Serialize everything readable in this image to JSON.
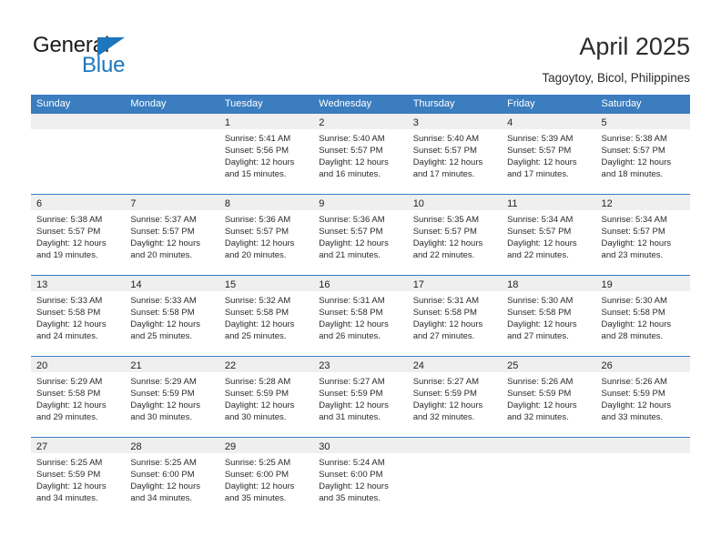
{
  "brand": {
    "name_part1": "General",
    "name_part2": "Blue",
    "triangle_color": "#1e76bd"
  },
  "header": {
    "title": "April 2025",
    "subtitle": "Tagoytoy, Bicol, Philippines"
  },
  "theme": {
    "header_blue": "#3b7dbf",
    "daynum_band": "#efefef",
    "text": "#2a2a2a"
  },
  "calendar": {
    "weekday_headers": [
      "Sunday",
      "Monday",
      "Tuesday",
      "Wednesday",
      "Thursday",
      "Friday",
      "Saturday"
    ],
    "weeks": [
      [
        {
          "day": "",
          "sunrise": "",
          "sunset": "",
          "daylight_line1": "",
          "daylight_line2": ""
        },
        {
          "day": "",
          "sunrise": "",
          "sunset": "",
          "daylight_line1": "",
          "daylight_line2": ""
        },
        {
          "day": "1",
          "sunrise": "Sunrise: 5:41 AM",
          "sunset": "Sunset: 5:56 PM",
          "daylight_line1": "Daylight: 12 hours",
          "daylight_line2": "and 15 minutes."
        },
        {
          "day": "2",
          "sunrise": "Sunrise: 5:40 AM",
          "sunset": "Sunset: 5:57 PM",
          "daylight_line1": "Daylight: 12 hours",
          "daylight_line2": "and 16 minutes."
        },
        {
          "day": "3",
          "sunrise": "Sunrise: 5:40 AM",
          "sunset": "Sunset: 5:57 PM",
          "daylight_line1": "Daylight: 12 hours",
          "daylight_line2": "and 17 minutes."
        },
        {
          "day": "4",
          "sunrise": "Sunrise: 5:39 AM",
          "sunset": "Sunset: 5:57 PM",
          "daylight_line1": "Daylight: 12 hours",
          "daylight_line2": "and 17 minutes."
        },
        {
          "day": "5",
          "sunrise": "Sunrise: 5:38 AM",
          "sunset": "Sunset: 5:57 PM",
          "daylight_line1": "Daylight: 12 hours",
          "daylight_line2": "and 18 minutes."
        }
      ],
      [
        {
          "day": "6",
          "sunrise": "Sunrise: 5:38 AM",
          "sunset": "Sunset: 5:57 PM",
          "daylight_line1": "Daylight: 12 hours",
          "daylight_line2": "and 19 minutes."
        },
        {
          "day": "7",
          "sunrise": "Sunrise: 5:37 AM",
          "sunset": "Sunset: 5:57 PM",
          "daylight_line1": "Daylight: 12 hours",
          "daylight_line2": "and 20 minutes."
        },
        {
          "day": "8",
          "sunrise": "Sunrise: 5:36 AM",
          "sunset": "Sunset: 5:57 PM",
          "daylight_line1": "Daylight: 12 hours",
          "daylight_line2": "and 20 minutes."
        },
        {
          "day": "9",
          "sunrise": "Sunrise: 5:36 AM",
          "sunset": "Sunset: 5:57 PM",
          "daylight_line1": "Daylight: 12 hours",
          "daylight_line2": "and 21 minutes."
        },
        {
          "day": "10",
          "sunrise": "Sunrise: 5:35 AM",
          "sunset": "Sunset: 5:57 PM",
          "daylight_line1": "Daylight: 12 hours",
          "daylight_line2": "and 22 minutes."
        },
        {
          "day": "11",
          "sunrise": "Sunrise: 5:34 AM",
          "sunset": "Sunset: 5:57 PM",
          "daylight_line1": "Daylight: 12 hours",
          "daylight_line2": "and 22 minutes."
        },
        {
          "day": "12",
          "sunrise": "Sunrise: 5:34 AM",
          "sunset": "Sunset: 5:57 PM",
          "daylight_line1": "Daylight: 12 hours",
          "daylight_line2": "and 23 minutes."
        }
      ],
      [
        {
          "day": "13",
          "sunrise": "Sunrise: 5:33 AM",
          "sunset": "Sunset: 5:58 PM",
          "daylight_line1": "Daylight: 12 hours",
          "daylight_line2": "and 24 minutes."
        },
        {
          "day": "14",
          "sunrise": "Sunrise: 5:33 AM",
          "sunset": "Sunset: 5:58 PM",
          "daylight_line1": "Daylight: 12 hours",
          "daylight_line2": "and 25 minutes."
        },
        {
          "day": "15",
          "sunrise": "Sunrise: 5:32 AM",
          "sunset": "Sunset: 5:58 PM",
          "daylight_line1": "Daylight: 12 hours",
          "daylight_line2": "and 25 minutes."
        },
        {
          "day": "16",
          "sunrise": "Sunrise: 5:31 AM",
          "sunset": "Sunset: 5:58 PM",
          "daylight_line1": "Daylight: 12 hours",
          "daylight_line2": "and 26 minutes."
        },
        {
          "day": "17",
          "sunrise": "Sunrise: 5:31 AM",
          "sunset": "Sunset: 5:58 PM",
          "daylight_line1": "Daylight: 12 hours",
          "daylight_line2": "and 27 minutes."
        },
        {
          "day": "18",
          "sunrise": "Sunrise: 5:30 AM",
          "sunset": "Sunset: 5:58 PM",
          "daylight_line1": "Daylight: 12 hours",
          "daylight_line2": "and 27 minutes."
        },
        {
          "day": "19",
          "sunrise": "Sunrise: 5:30 AM",
          "sunset": "Sunset: 5:58 PM",
          "daylight_line1": "Daylight: 12 hours",
          "daylight_line2": "and 28 minutes."
        }
      ],
      [
        {
          "day": "20",
          "sunrise": "Sunrise: 5:29 AM",
          "sunset": "Sunset: 5:58 PM",
          "daylight_line1": "Daylight: 12 hours",
          "daylight_line2": "and 29 minutes."
        },
        {
          "day": "21",
          "sunrise": "Sunrise: 5:29 AM",
          "sunset": "Sunset: 5:59 PM",
          "daylight_line1": "Daylight: 12 hours",
          "daylight_line2": "and 30 minutes."
        },
        {
          "day": "22",
          "sunrise": "Sunrise: 5:28 AM",
          "sunset": "Sunset: 5:59 PM",
          "daylight_line1": "Daylight: 12 hours",
          "daylight_line2": "and 30 minutes."
        },
        {
          "day": "23",
          "sunrise": "Sunrise: 5:27 AM",
          "sunset": "Sunset: 5:59 PM",
          "daylight_line1": "Daylight: 12 hours",
          "daylight_line2": "and 31 minutes."
        },
        {
          "day": "24",
          "sunrise": "Sunrise: 5:27 AM",
          "sunset": "Sunset: 5:59 PM",
          "daylight_line1": "Daylight: 12 hours",
          "daylight_line2": "and 32 minutes."
        },
        {
          "day": "25",
          "sunrise": "Sunrise: 5:26 AM",
          "sunset": "Sunset: 5:59 PM",
          "daylight_line1": "Daylight: 12 hours",
          "daylight_line2": "and 32 minutes."
        },
        {
          "day": "26",
          "sunrise": "Sunrise: 5:26 AM",
          "sunset": "Sunset: 5:59 PM",
          "daylight_line1": "Daylight: 12 hours",
          "daylight_line2": "and 33 minutes."
        }
      ],
      [
        {
          "day": "27",
          "sunrise": "Sunrise: 5:25 AM",
          "sunset": "Sunset: 5:59 PM",
          "daylight_line1": "Daylight: 12 hours",
          "daylight_line2": "and 34 minutes."
        },
        {
          "day": "28",
          "sunrise": "Sunrise: 5:25 AM",
          "sunset": "Sunset: 6:00 PM",
          "daylight_line1": "Daylight: 12 hours",
          "daylight_line2": "and 34 minutes."
        },
        {
          "day": "29",
          "sunrise": "Sunrise: 5:25 AM",
          "sunset": "Sunset: 6:00 PM",
          "daylight_line1": "Daylight: 12 hours",
          "daylight_line2": "and 35 minutes."
        },
        {
          "day": "30",
          "sunrise": "Sunrise: 5:24 AM",
          "sunset": "Sunset: 6:00 PM",
          "daylight_line1": "Daylight: 12 hours",
          "daylight_line2": "and 35 minutes."
        },
        {
          "day": "",
          "sunrise": "",
          "sunset": "",
          "daylight_line1": "",
          "daylight_line2": ""
        },
        {
          "day": "",
          "sunrise": "",
          "sunset": "",
          "daylight_line1": "",
          "daylight_line2": ""
        },
        {
          "day": "",
          "sunrise": "",
          "sunset": "",
          "daylight_line1": "",
          "daylight_line2": ""
        }
      ]
    ]
  }
}
